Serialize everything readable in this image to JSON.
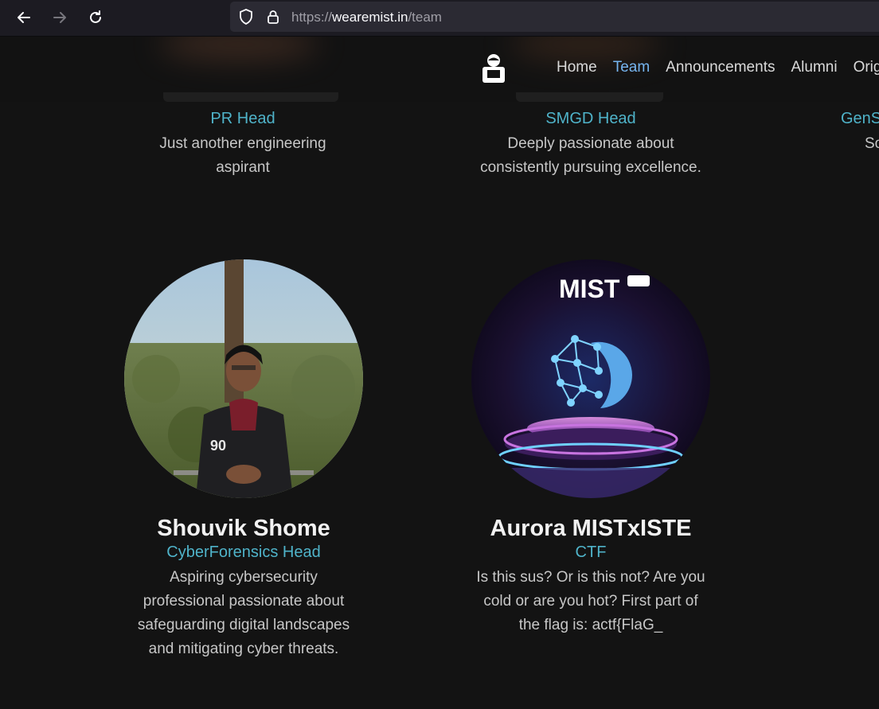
{
  "browser": {
    "url_scheme": "https://",
    "url_host": "wearemist.in",
    "url_path": "/team"
  },
  "nav": {
    "items": [
      "Home",
      "Team",
      "Announcements",
      "Alumni",
      "Orig"
    ],
    "active_index": 1
  },
  "top_cards": [
    {
      "role": "PR Head",
      "desc_lines": [
        "Just another engineering",
        "aspirant"
      ]
    },
    {
      "role": "SMGD Head",
      "desc_lines": [
        "Deeply passionate about",
        "consistently pursuing excellence."
      ]
    },
    {
      "role": "GenS",
      "desc_lines": [
        "So"
      ]
    }
  ],
  "cards": [
    {
      "name": "Shouvik Shome",
      "role": "CyberForensics Head",
      "desc_lines": [
        "Aspiring cybersecurity",
        "professional passionate about",
        "safeguarding digital landscapes",
        "and mitigating cyber threats."
      ]
    },
    {
      "name": "Aurora MISTxISTE",
      "role": "CTF",
      "desc_lines": [
        "Is this sus? Or is this not? Are you",
        "cold or are you hot? First part of",
        "the flag is: actf{FlaG_"
      ],
      "logo_text": "MIST"
    }
  ],
  "colors": {
    "accent_role": "#4fb3c9",
    "nav_active": "#76b5f0",
    "background": "#131313"
  }
}
